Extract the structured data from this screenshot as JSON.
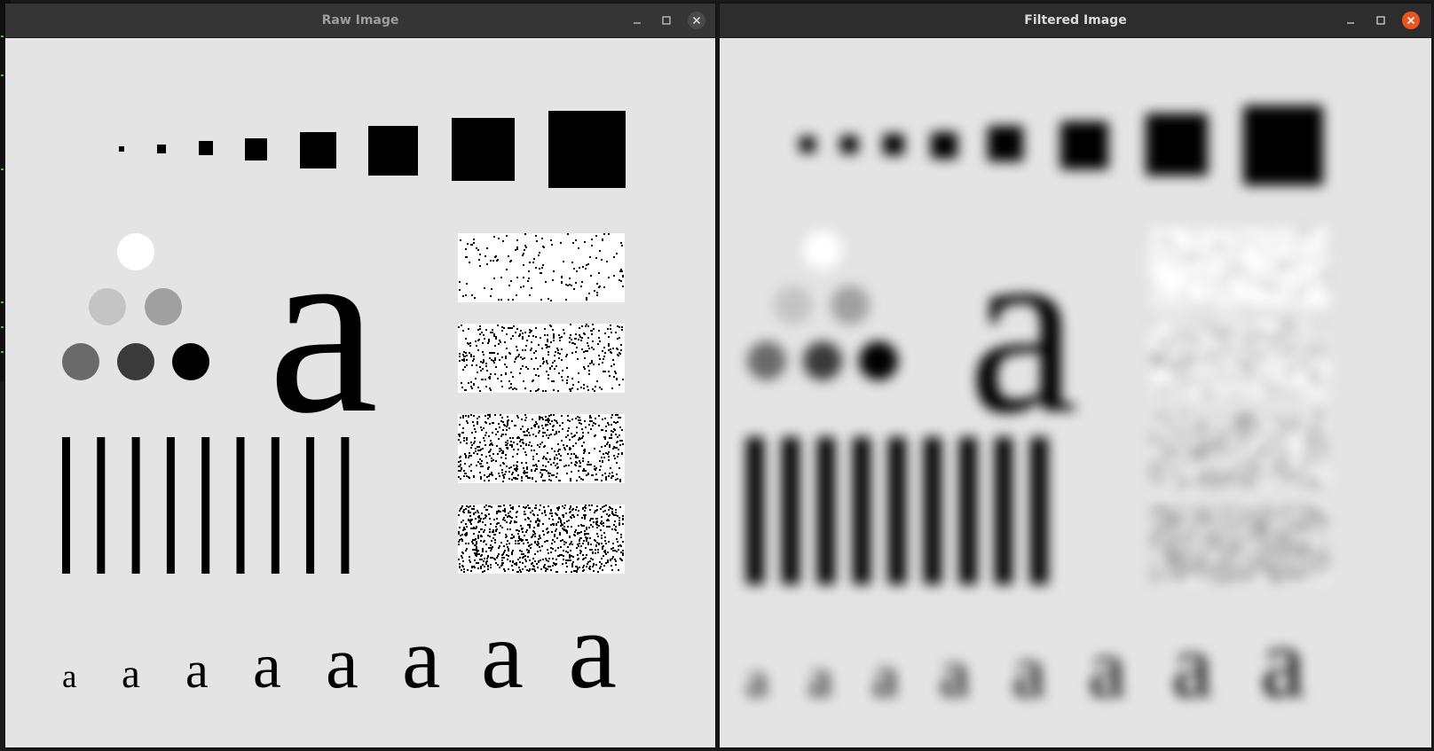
{
  "windows": {
    "raw": {
      "title": "Raw Image",
      "controls": [
        "minimize-icon",
        "maximize-icon",
        "close-icon"
      ]
    },
    "filtered": {
      "title": "Filtered Image",
      "controls": [
        "minimize-icon",
        "maximize-icon",
        "close-icon"
      ]
    }
  },
  "test_pattern": {
    "glyph": "a",
    "squares_count": 8,
    "circle_gray_levels": [
      "#ffffff",
      "#c4c4c4",
      "#a0a0a0",
      "#6a6a6a",
      "#3a3a3a",
      "#000000"
    ],
    "bars_count": 9,
    "noise_density_levels": [
      0.1,
      0.25,
      0.4,
      0.55
    ],
    "small_letters_count": 8
  },
  "colors": {
    "background": "#e4e4e4",
    "titlebar": "#2d2d2d",
    "close_active": "#e95420",
    "terminal_green": "#3ec43e"
  }
}
